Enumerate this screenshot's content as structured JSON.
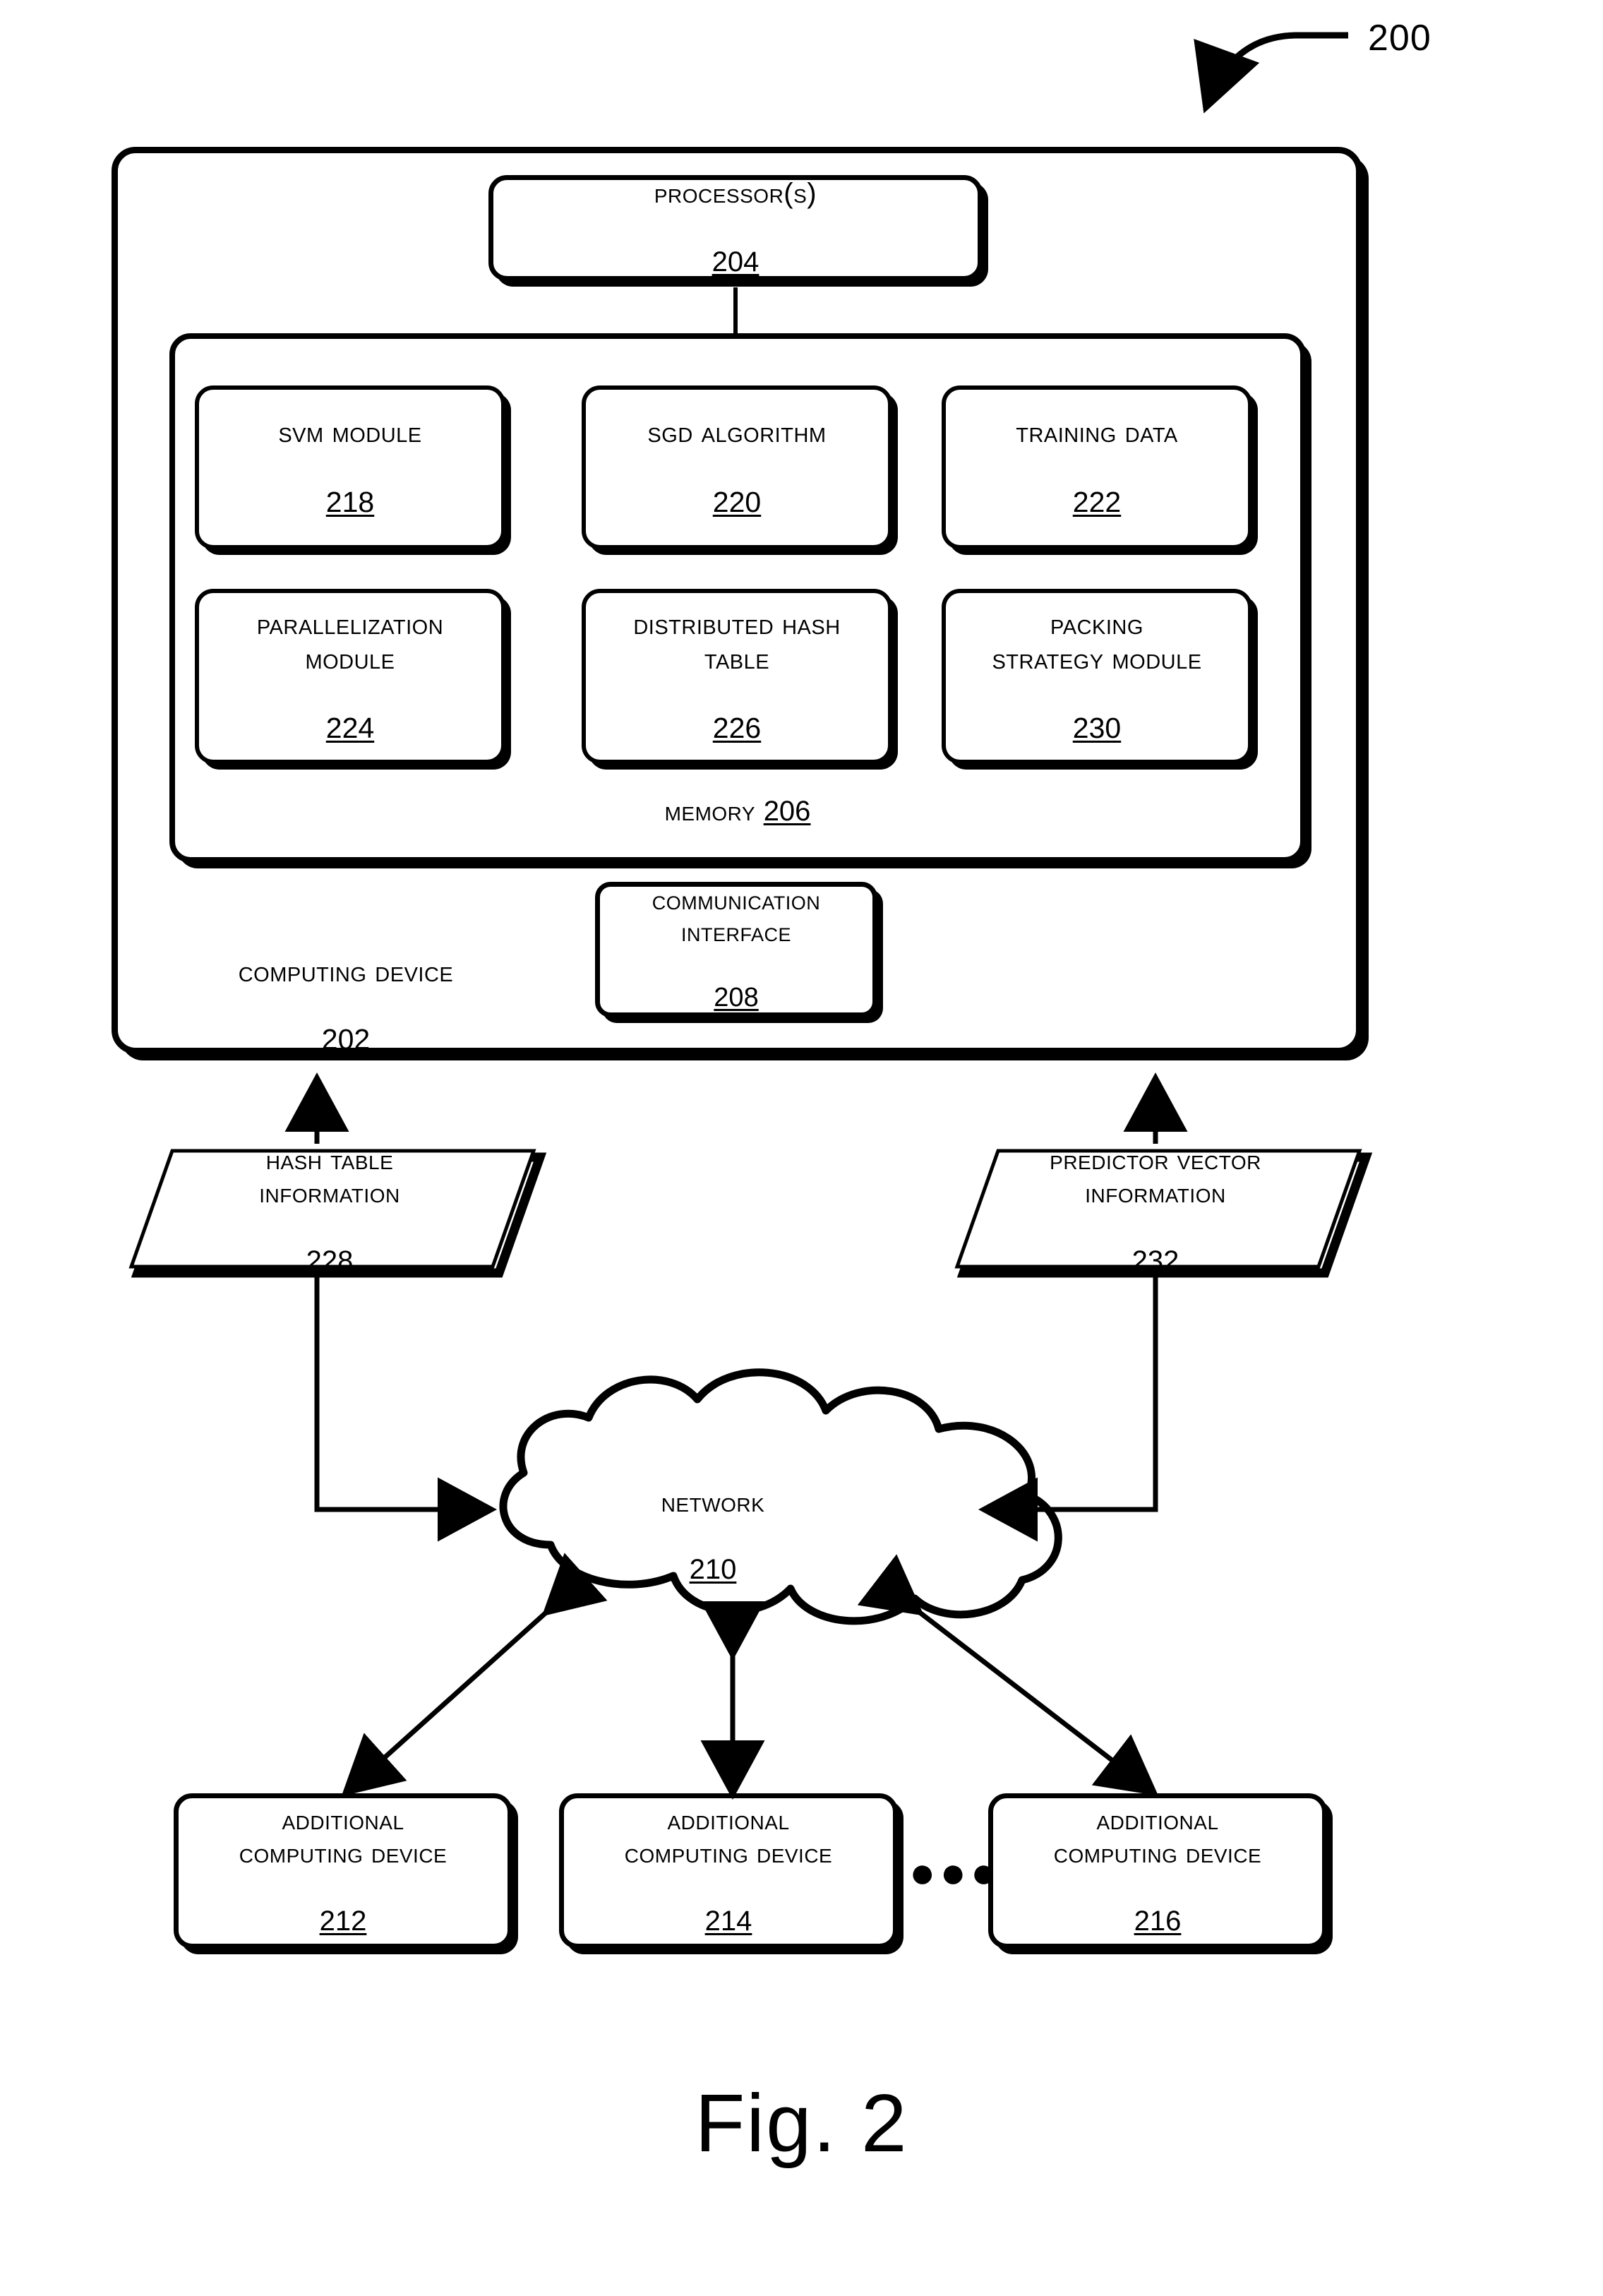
{
  "figure": {
    "caption": "Fig. 2",
    "system_ref": "200"
  },
  "computing_device": {
    "label": "Computing Device",
    "ref": "202"
  },
  "processor": {
    "label": "Processor(s)",
    "ref": "204"
  },
  "memory": {
    "label": "Memory",
    "ref": "206",
    "modules": [
      {
        "label": "SVM Module",
        "ref": "218"
      },
      {
        "label": "SGD Algorithm",
        "ref": "220"
      },
      {
        "label": "Training Data",
        "ref": "222"
      },
      {
        "label": "Parallelization\nModule",
        "ref": "224"
      },
      {
        "label": "Distributed Hash\nTable",
        "ref": "226"
      },
      {
        "label": "Packing\nStrategy Module",
        "ref": "230"
      }
    ]
  },
  "communication_interface": {
    "label": "Communication\nInterface",
    "ref": "208"
  },
  "data_objects": [
    {
      "label": "Hash Table\nInformation",
      "ref": "228"
    },
    {
      "label": "Predictor Vector\nInformation",
      "ref": "232"
    }
  ],
  "network": {
    "label": "Network",
    "ref": "210"
  },
  "additional_devices": [
    {
      "label": "Additional\nComputing Device",
      "ref": "212"
    },
    {
      "label": "Additional\nComputing Device",
      "ref": "214"
    },
    {
      "label": "Additional\nComputing Device",
      "ref": "216"
    }
  ],
  "ellipsis": "●●●",
  "colors": {
    "stroke": "#000000",
    "background": "#ffffff"
  }
}
